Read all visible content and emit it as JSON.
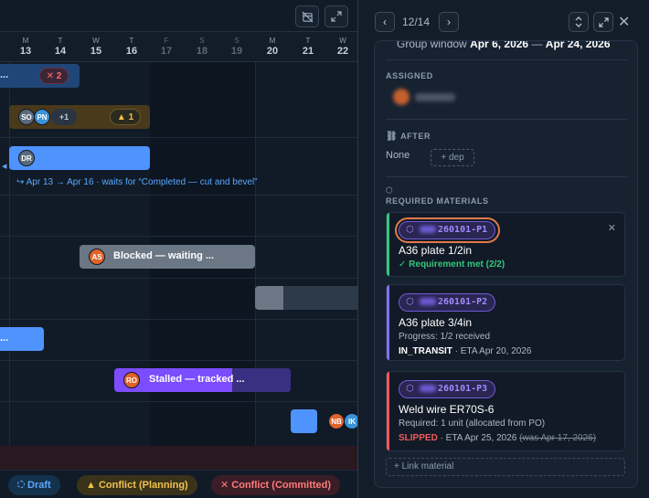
{
  "timeline": {
    "days": [
      {
        "dow": "M",
        "num": "13"
      },
      {
        "dow": "T",
        "num": "14"
      },
      {
        "dow": "W",
        "num": "15"
      },
      {
        "dow": "T",
        "num": "16"
      },
      {
        "dow": "F",
        "num": "17"
      },
      {
        "dow": "S",
        "num": "18"
      },
      {
        "dow": "S",
        "num": "19"
      },
      {
        "dow": "M",
        "num": "20"
      },
      {
        "dow": "T",
        "num": "21"
      },
      {
        "dow": "W",
        "num": "22"
      }
    ],
    "bars": {
      "row1_label": "...",
      "row1_conflict_count": "2",
      "row2_avatars": [
        "SO",
        "PN"
      ],
      "row2_more": "+1",
      "row2_warning_count": "1",
      "row3_avatar": "DR",
      "dependency_note": "Apr 13 → Apr 16 · waits for “Completed — cut and bevel”",
      "blocked_avatar": "AS",
      "blocked_label": "Blocked — waiting ...",
      "row7_label": "...",
      "stalled_avatar": "RO",
      "stalled_label": "Stalled — tracked ...",
      "row9_avatars": [
        "NB",
        "IK"
      ]
    },
    "legend": {
      "draft": "Draft",
      "conflict_planning": "Conflict (Planning)",
      "conflict_committed": "Conflict (Committed)"
    },
    "colors": {
      "accent_blue": "#4f93ff",
      "blocked": "#6b7785",
      "stalled": "#7c4dff",
      "warning": "#f2c14e",
      "danger": "#f05a5a"
    }
  },
  "panel": {
    "pager": "12/14",
    "group_window": {
      "label": "Group window",
      "start": "Apr 6, 2026",
      "end": "Apr 24, 2026"
    },
    "assigned_title": "ASSIGNED",
    "after_title": "AFTER",
    "after_value": "None",
    "add_dep_label": "+ dep",
    "materials_title": "REQUIRED MATERIALS",
    "materials": [
      {
        "code_suffix": "260101-P1",
        "name": "A36 plate 1/2in",
        "line1": "✓ Requirement met (2/2)",
        "line2": "",
        "status_color": "#34c77b"
      },
      {
        "code_suffix": "260101-P2",
        "name": "A36 plate 3/4in",
        "line1": "Progress: 1/2 received",
        "status": "IN_TRANSIT",
        "eta": " · ETA Apr 20, 2026",
        "status_color": "#8b6cff"
      },
      {
        "code_suffix": "260101-P3",
        "name": "Weld wire ER70S-6",
        "line1": "Required: 1 unit (allocated from PO)",
        "status": "SLIPPED",
        "eta": " · ETA Apr 25, 2026 ",
        "was": "(was Apr 17, 2026)",
        "status_color": "#f05a5a"
      }
    ],
    "link_material_label": "+ Link material"
  }
}
